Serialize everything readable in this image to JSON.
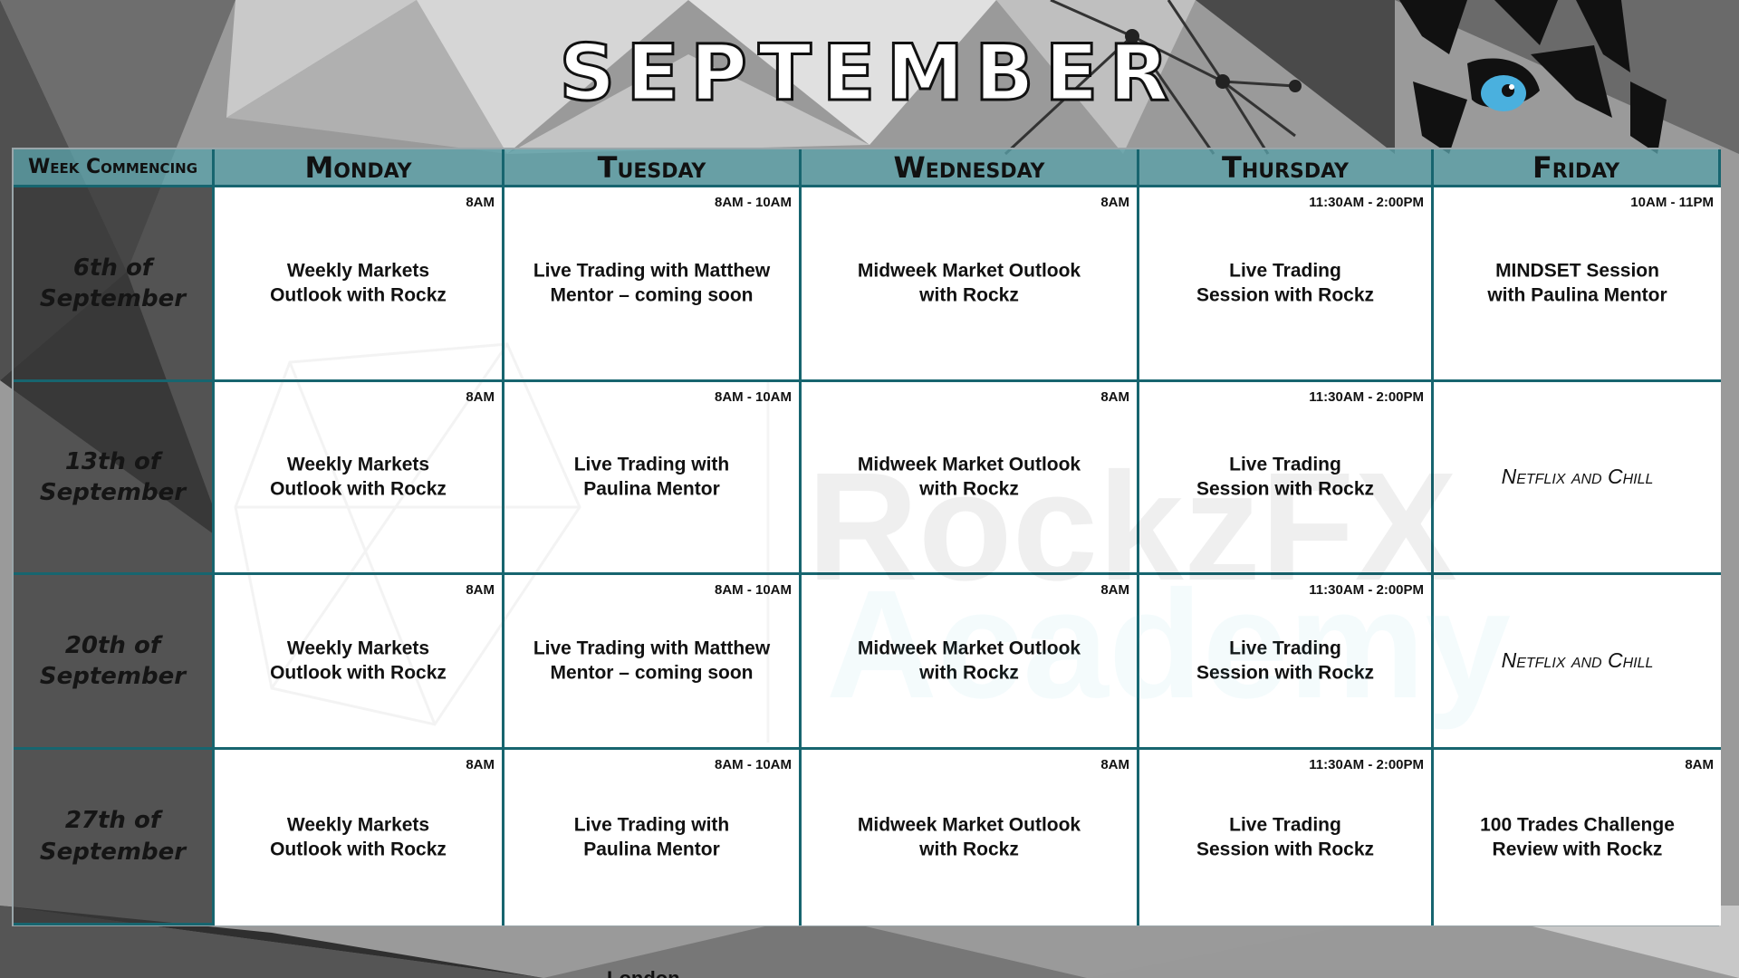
{
  "title": "SEPTEMBER",
  "headers": {
    "week": "Week Commencing",
    "days": [
      "Monday",
      "Tuesday",
      "Wednesday",
      "Thursday",
      "Friday"
    ]
  },
  "weeks": [
    {
      "label": "6th of\nSeptember",
      "sessions": [
        {
          "time": "8AM",
          "title": "Weekly Markets\nOutlook with Rockz"
        },
        {
          "time": "8AM - 10AM",
          "title": "Live Trading with Matthew\nMentor – coming soon"
        },
        {
          "time": "8AM",
          "title": "Midweek Market Outlook\nwith Rockz"
        },
        {
          "time": "11:30AM - 2:00PM",
          "title": "Live Trading\nSession with Rockz"
        },
        {
          "time": "10AM - 11PM",
          "title": "MINDSET Session\nwith Paulina Mentor"
        }
      ]
    },
    {
      "label": "13th of\nSeptember",
      "sessions": [
        {
          "time": "8AM",
          "title": "Weekly Markets\nOutlook with Rockz"
        },
        {
          "time": "8AM - 10AM",
          "title": "Live Trading with\nPaulina Mentor"
        },
        {
          "time": "8AM",
          "title": "Midweek Market Outlook\nwith Rockz"
        },
        {
          "time": "11:30AM - 2:00PM",
          "title": "Live Trading\nSession with Rockz"
        },
        {
          "time": "",
          "title": "Netflix and Chill",
          "italic": true
        }
      ]
    },
    {
      "label": "20th of\nSeptember",
      "sessions": [
        {
          "time": "8AM",
          "title": "Weekly Markets\nOutlook with Rockz"
        },
        {
          "time": "8AM - 10AM",
          "title": "Live Trading with Matthew\nMentor – coming soon"
        },
        {
          "time": "8AM",
          "title": "Midweek Market Outlook\nwith Rockz"
        },
        {
          "time": "11:30AM - 2:00PM",
          "title": "Live Trading\nSession with Rockz"
        },
        {
          "time": "",
          "title": "Netflix and Chill",
          "italic": true
        }
      ]
    },
    {
      "label": "27th of\nSeptember",
      "sessions": [
        {
          "time": "8AM",
          "title": "Weekly Markets\nOutlook with Rockz"
        },
        {
          "time": "8AM - 10AM",
          "title": "Live Trading with\nPaulina Mentor"
        },
        {
          "time": "8AM",
          "title": "Midweek Market Outlook\nwith Rockz"
        },
        {
          "time": "11:30AM - 2:00PM",
          "title": "Live Trading\nSession with Rockz"
        },
        {
          "time": "8AM",
          "title": "100 Trades Challenge\nReview with Rockz"
        }
      ]
    }
  ],
  "watermark": {
    "line1": "RockzFX",
    "line2": "Academy"
  },
  "footer": "London",
  "colors": {
    "grid_border": "#17656f",
    "header_fill": "#5aa0a8",
    "week_fill": "#373737",
    "tiger_eye": "#4ab0de"
  },
  "icons": [
    "tiger-logo-icon",
    "tiger-eye-icon"
  ]
}
